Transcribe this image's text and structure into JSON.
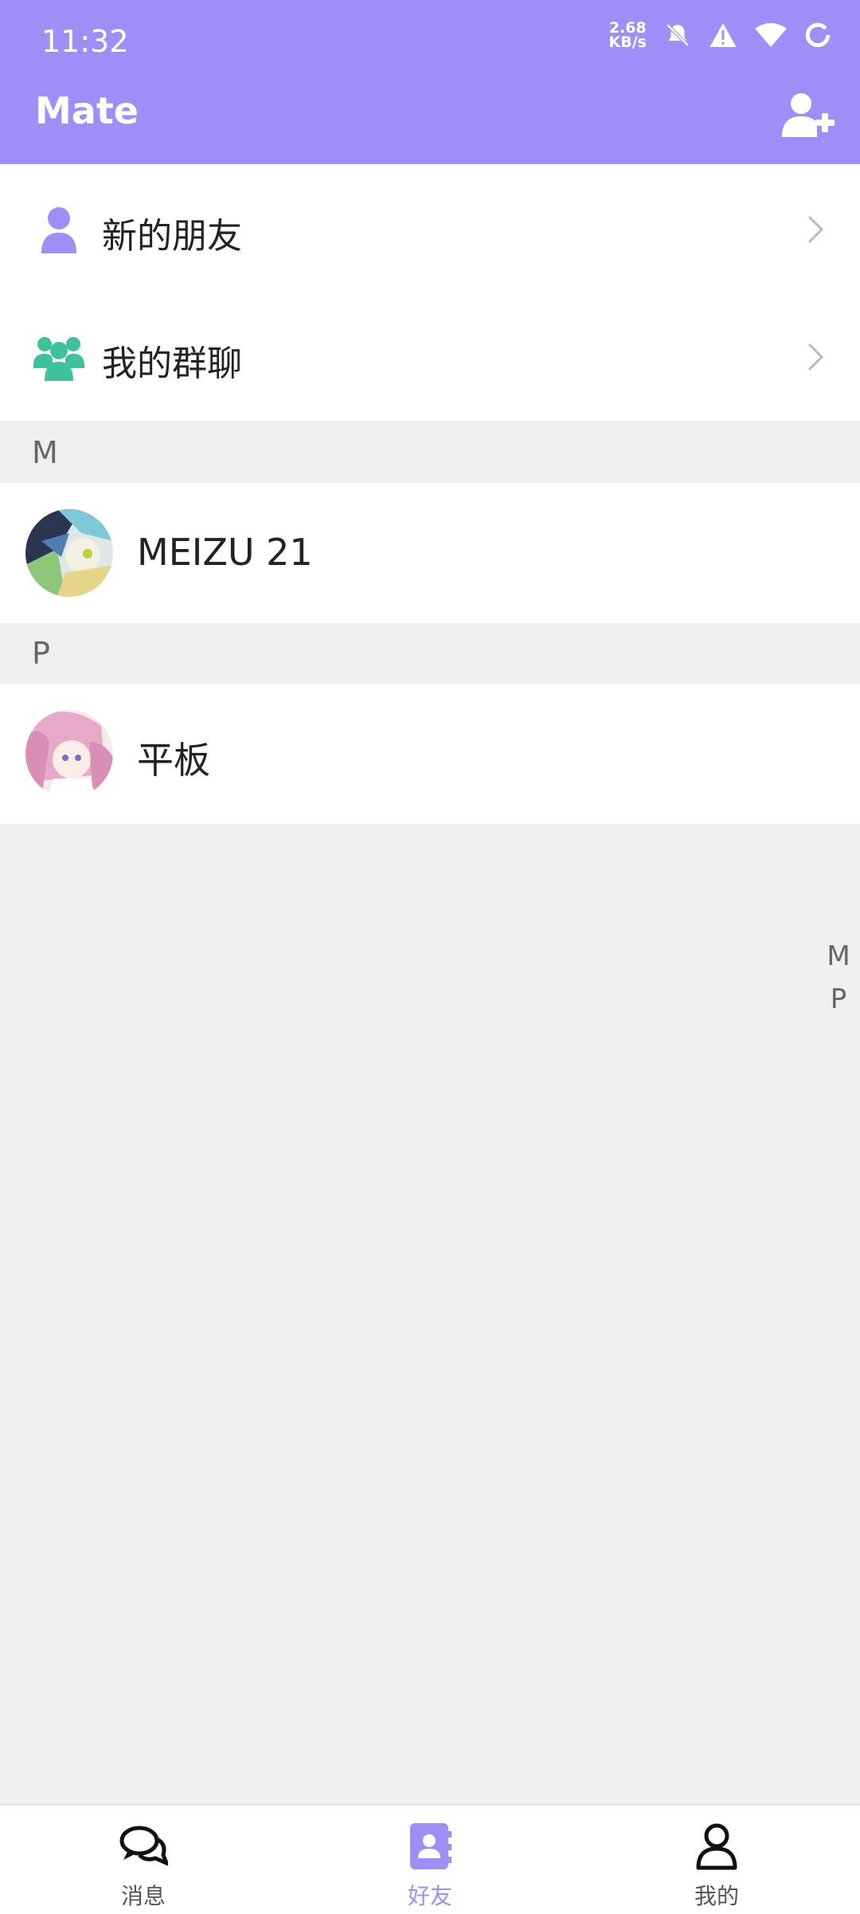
{
  "status_bar": {
    "time": "11:32",
    "net_speed_value": "2.68",
    "net_speed_unit": "KB/s",
    "icons": [
      "mute-icon",
      "warning-icon",
      "wifi-icon",
      "battery-ring-icon"
    ]
  },
  "header": {
    "title": "Mate",
    "action_icon": "add-user-icon"
  },
  "menu": {
    "items": [
      {
        "label": "新的朋友",
        "icon": "person-icon",
        "color": "#9d8ff7"
      },
      {
        "label": "我的群聊",
        "icon": "group-icon",
        "color": "#3ec29a"
      }
    ]
  },
  "contacts": {
    "sections": [
      {
        "letter": "M",
        "items": [
          {
            "name": "MEIZU 21"
          }
        ]
      },
      {
        "letter": "P",
        "items": [
          {
            "name": "平板"
          }
        ]
      }
    ]
  },
  "index_bar": {
    "letters": [
      "M",
      "P"
    ]
  },
  "tabbar": {
    "tabs": [
      {
        "label": "消息",
        "icon": "chat-bubbles-icon",
        "active": false
      },
      {
        "label": "好友",
        "icon": "contacts-book-icon",
        "active": true
      },
      {
        "label": "我的",
        "icon": "user-outline-icon",
        "active": false
      }
    ]
  },
  "colors": {
    "accent": "#9d8ff7",
    "group": "#3ec29a",
    "background": "#f0f0f0"
  }
}
